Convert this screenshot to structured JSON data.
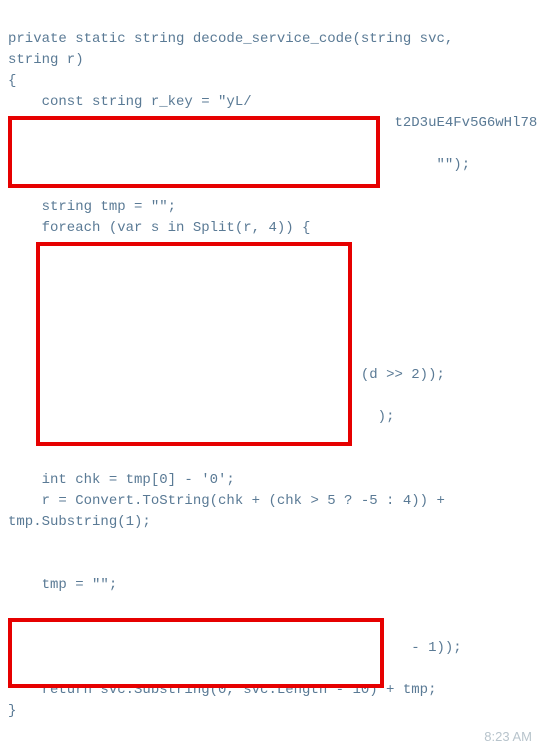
{
  "code": {
    "line1": "private static string decode_service_code(string svc,",
    "line2": "string r)",
    "line3": "{",
    "line4": "    const string r_key = \"yL/",
    "line5_partial": "t2D3uE4Fv5G6wHl78",
    "line6": "",
    "line7_partial": "\"\");",
    "line8": "",
    "line9": "    string tmp = \"\";",
    "line10": "    foreach (var s in Split(r, 4)) {",
    "line11": "",
    "line12": "",
    "line13": "",
    "line14": "",
    "line15": "",
    "line16": "",
    "line17_partial": "(d >> 2));",
    "line18": "",
    "line19_partial": ");",
    "line20": "    }",
    "line21": "",
    "line22": "    int chk = tmp[0] - '0';",
    "line23": "    r = Convert.ToString(chk + (chk > 5 ? -5 : 4)) +",
    "line24": "tmp.Substring(1);",
    "line25": "",
    "line26": "",
    "line27": "    tmp = \"\";",
    "line28": "",
    "line29": "",
    "line30_partial": " - 1));",
    "line31": "    }",
    "line32": "    return svc.Substring(0, svc.Length - 10) + tmp;",
    "line33": "}"
  },
  "timestamp": "8:23 AM"
}
